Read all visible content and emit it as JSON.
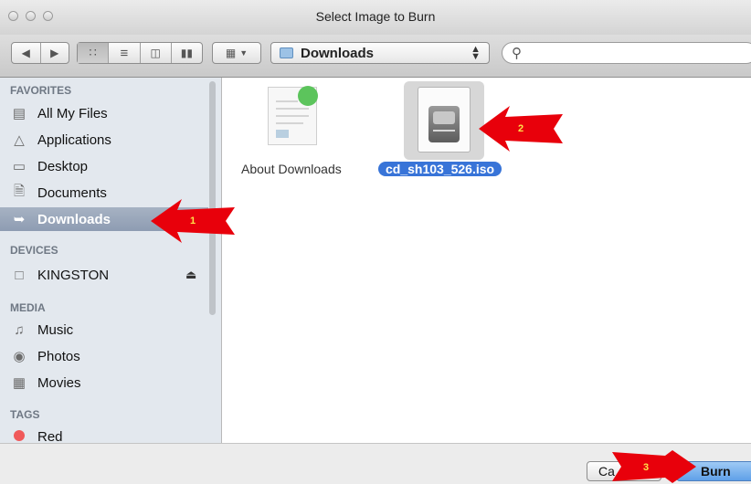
{
  "window": {
    "title": "Select Image to Burn"
  },
  "toolbar": {
    "location": "Downloads",
    "search": {
      "value": "",
      "placeholder": ""
    }
  },
  "sidebar": {
    "favorites_header": "FAVORITES",
    "favorites": [
      {
        "label": "All My Files",
        "icon": "all-files-icon"
      },
      {
        "label": "Applications",
        "icon": "applications-icon"
      },
      {
        "label": "Desktop",
        "icon": "desktop-icon"
      },
      {
        "label": "Documents",
        "icon": "documents-icon"
      },
      {
        "label": "Downloads",
        "icon": "downloads-icon",
        "selected": true
      }
    ],
    "devices_header": "DEVICES",
    "devices": [
      {
        "label": "KINGSTON",
        "icon": "drive-icon"
      }
    ],
    "media_header": "MEDIA",
    "media": [
      {
        "label": "Music",
        "icon": "music-icon"
      },
      {
        "label": "Photos",
        "icon": "camera-icon"
      },
      {
        "label": "Movies",
        "icon": "film-icon"
      }
    ],
    "tags_header": "TAGS",
    "tags": [
      {
        "label": "Red",
        "color": "#f0595a"
      }
    ]
  },
  "files": [
    {
      "name": "About Downloads",
      "selected": false
    },
    {
      "name": "cd_sh103_526.iso",
      "selected": true
    }
  ],
  "footer": {
    "cancel_label": "Ca",
    "burn_label": "Burn"
  },
  "annotations": {
    "arrow1": "1",
    "arrow2": "2",
    "arrow3": "3",
    "arrow_color": "#e8000b"
  }
}
